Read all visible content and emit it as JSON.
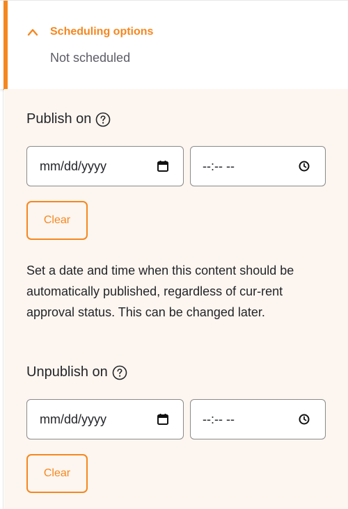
{
  "scheduling": {
    "toggle_label": "Scheduling options",
    "status": "Not scheduled"
  },
  "publish": {
    "heading": "Publish on",
    "date_placeholder": "mm/dd/yyyy",
    "time_placeholder": "--:-- --",
    "clear_label": "Clear",
    "help_text": "Set a date and time when this content should be automatically published, regardless of cur-rent approval status. This can be changed later."
  },
  "unpublish": {
    "heading": "Unpublish on",
    "date_placeholder": "mm/dd/yyyy",
    "time_placeholder": "--:-- --",
    "clear_label": "Clear"
  },
  "colors": {
    "accent": "#f5871f",
    "panel_background": "#fdf6f0",
    "text": "#232429",
    "muted_text": "#5c5c66"
  },
  "icons": {
    "toggle": "chevron-up-icon",
    "help": "question-circle-icon",
    "date_picker": "calendar-icon",
    "time_picker": "clock-icon"
  }
}
